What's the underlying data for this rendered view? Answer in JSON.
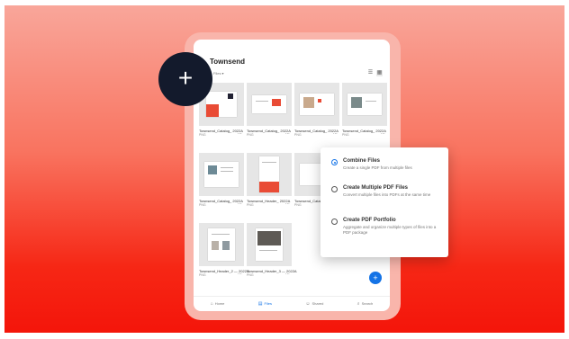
{
  "app": {
    "title": "Townsend",
    "subtitle": "Files ▾"
  },
  "view_toggle": {
    "list_icon": "☰",
    "grid_icon": "▦"
  },
  "files": [
    {
      "name": "Townsend_Catalog_ 2022A",
      "meta": "PNG"
    },
    {
      "name": "Townsend_Catalog_ 2022A",
      "meta": "PNG"
    },
    {
      "name": "Townsend_Catalog_ 2022A",
      "meta": "PNG"
    },
    {
      "name": "Townsend_Catalog_ 2022A",
      "meta": "PNG"
    },
    {
      "name": "Townsend_Catalog_ 2022A",
      "meta": "PNG"
    },
    {
      "name": "Townsend_Header_ 2022A",
      "meta": "PNG"
    },
    {
      "name": "Townsend_Catalog_ 3_2022A",
      "meta": "PNG"
    },
    {
      "name": "Townsend_Header_2 — 2022A",
      "meta": "PNG"
    },
    {
      "name": "Townsend_Header_3 — 2022A",
      "meta": "PNG"
    }
  ],
  "more_icon": "⋯",
  "fab_plus": "+",
  "add_button": "+",
  "menu": {
    "options": [
      {
        "title": "Combine Files",
        "desc": "Create a single PDF from multiple files"
      },
      {
        "title": "Create Multiple PDF Files",
        "desc": "Convert multiple files into PDFs at the same time"
      },
      {
        "title": "Create PDF Portfolio",
        "desc": "Aggregate and organize multiple types of files into a PDF package"
      }
    ]
  },
  "bottom_nav": [
    {
      "icon": "⌂",
      "label": "Home"
    },
    {
      "icon": "▤",
      "label": "Files"
    },
    {
      "icon": "☺",
      "label": "Shared"
    },
    {
      "icon": "⌕",
      "label": "Search"
    }
  ],
  "colors": {
    "accent": "#1473e6",
    "plus_bg": "#131a2c",
    "gradient_top": "#f9a69a",
    "gradient_bottom": "#f4150a"
  }
}
